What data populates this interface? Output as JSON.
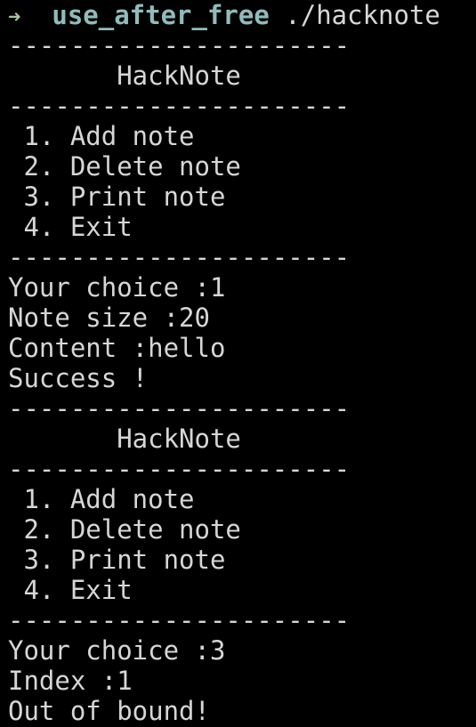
{
  "prompt": {
    "arrow": "➜",
    "directory": "use_after_free",
    "command": "./hacknote"
  },
  "colors": {
    "background": "#000000",
    "text": "#d6d6d6",
    "prompt_arrow": "#a8c49a",
    "prompt_directory": "#8fbcbb"
  },
  "output": [
    "----------------------",
    "       HackNote",
    "----------------------",
    " 1. Add note",
    " 2. Delete note",
    " 3. Print note",
    " 4. Exit",
    "----------------------",
    "Your choice :1",
    "Note size :20",
    "Content :hello",
    "Success !",
    "----------------------",
    "       HackNote",
    "----------------------",
    " 1. Add note",
    " 2. Delete note",
    " 3. Print note",
    " 4. Exit",
    "----------------------",
    "Your choice :3",
    "Index :1",
    "Out of bound!"
  ]
}
